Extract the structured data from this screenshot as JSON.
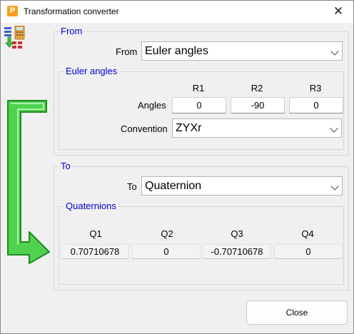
{
  "window": {
    "title": "Transformation converter"
  },
  "from_group": {
    "legend": "From",
    "from_label": "From",
    "from_value": "Euler angles"
  },
  "euler_group": {
    "legend": "Euler angles",
    "col_headers": [
      "R1",
      "R2",
      "R3"
    ],
    "angles_label": "Angles",
    "angles": [
      "0",
      "-90",
      "0"
    ],
    "convention_label": "Convention",
    "convention_value": "ZYXr"
  },
  "to_group": {
    "legend": "To",
    "to_label": "To",
    "to_value": "Quaternion"
  },
  "quat_group": {
    "legend": "Quaternions",
    "col_headers": [
      "Q1",
      "Q2",
      "Q3",
      "Q4"
    ],
    "values": [
      "0.70710678",
      "0",
      "-0.70710678",
      "0"
    ]
  },
  "buttons": {
    "close": "Close"
  },
  "icons": [
    "app-icon",
    "close-icon",
    "converter-logo-icon",
    "green-arrow-icon",
    "chevron-down-icon"
  ],
  "colors": {
    "legend": "#0000d0",
    "arrow": "#3cc43c"
  }
}
